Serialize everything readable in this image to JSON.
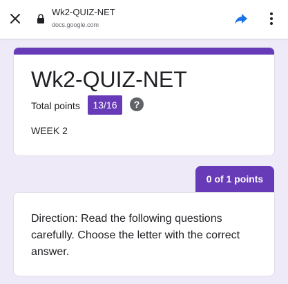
{
  "browser": {
    "page_title": "Wk2-QUIZ-NET",
    "domain": "docs.google.com"
  },
  "form": {
    "title": "Wk2-QUIZ-NET",
    "total_points_label": "Total points",
    "score": "13/16",
    "description": "WEEK 2",
    "accent_color": "#673ab7"
  },
  "question": {
    "points": "0 of 1 points",
    "text": "Direction:  Read the following questions carefully. Choose the letter with the correct  answer."
  },
  "icons": [
    "close-icon",
    "lock-icon",
    "share-icon",
    "more-vert-icon",
    "help-icon"
  ]
}
